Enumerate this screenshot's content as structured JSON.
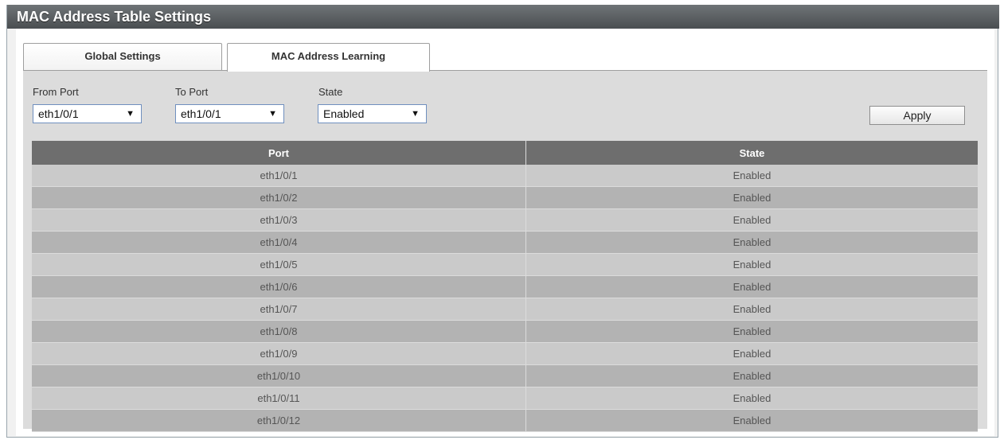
{
  "title": "MAC Address Table Settings",
  "tabs": [
    {
      "label": "Global Settings",
      "active": false
    },
    {
      "label": "MAC Address Learning",
      "active": true
    }
  ],
  "form": {
    "from_port": {
      "label": "From Port",
      "value": "eth1/0/1"
    },
    "to_port": {
      "label": "To Port",
      "value": "eth1/0/1"
    },
    "state": {
      "label": "State",
      "value": "Enabled"
    },
    "apply_label": "Apply"
  },
  "table": {
    "headers": [
      "Port",
      "State"
    ],
    "rows": [
      [
        "eth1/0/1",
        "Enabled"
      ],
      [
        "eth1/0/2",
        "Enabled"
      ],
      [
        "eth1/0/3",
        "Enabled"
      ],
      [
        "eth1/0/4",
        "Enabled"
      ],
      [
        "eth1/0/5",
        "Enabled"
      ],
      [
        "eth1/0/6",
        "Enabled"
      ],
      [
        "eth1/0/7",
        "Enabled"
      ],
      [
        "eth1/0/8",
        "Enabled"
      ],
      [
        "eth1/0/9",
        "Enabled"
      ],
      [
        "eth1/0/10",
        "Enabled"
      ],
      [
        "eth1/0/11",
        "Enabled"
      ],
      [
        "eth1/0/12",
        "Enabled"
      ]
    ]
  },
  "icons": {
    "dropdown": "chevron-down-icon"
  }
}
